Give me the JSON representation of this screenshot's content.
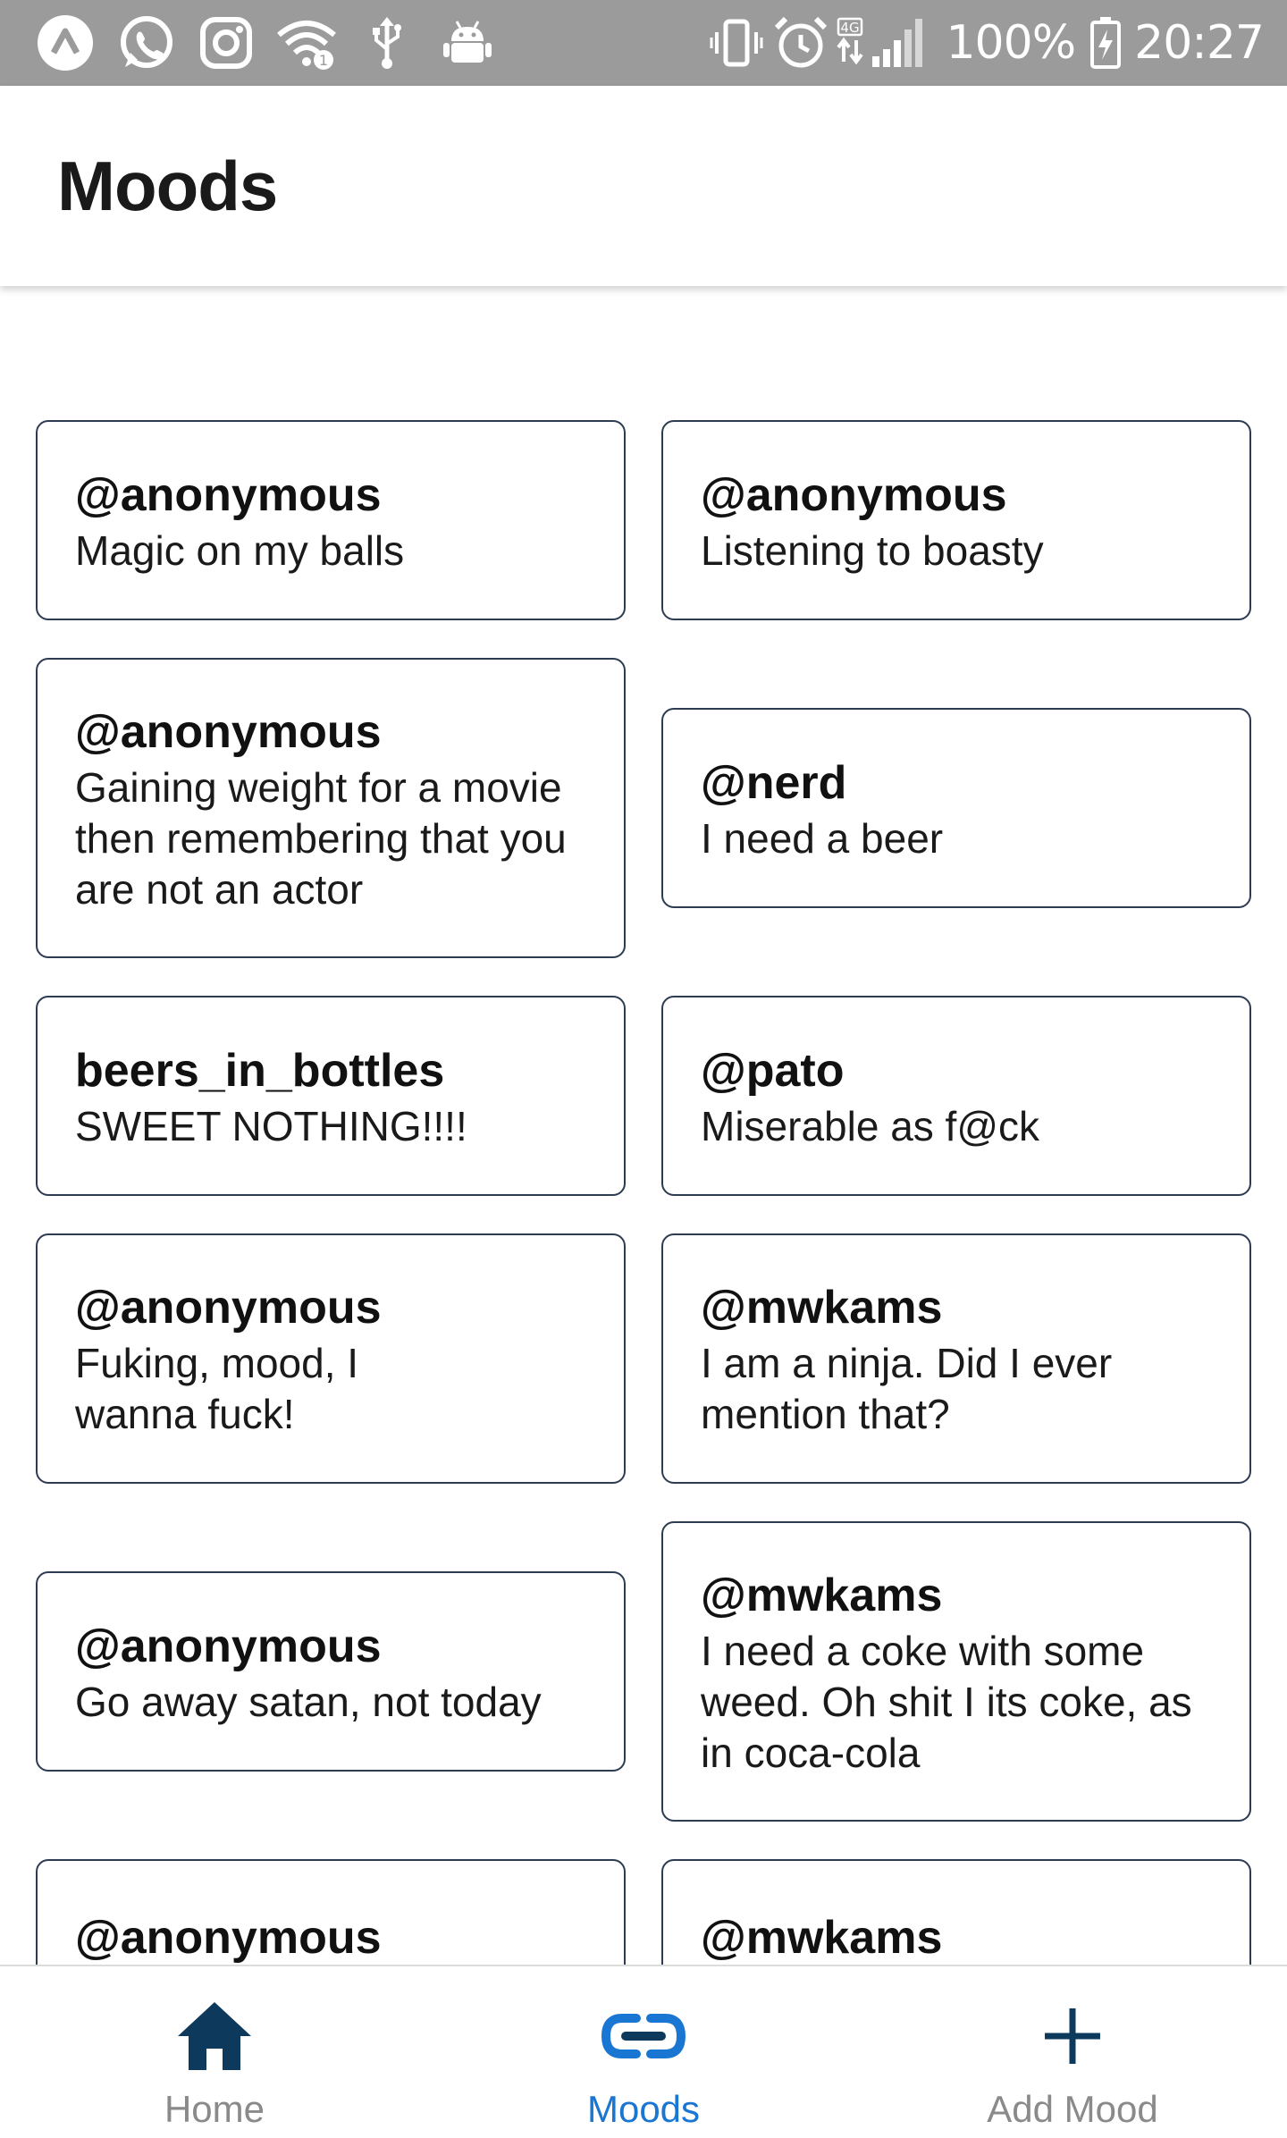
{
  "status_bar": {
    "battery": "100%",
    "time": "20:27",
    "network": "4G",
    "left_icons": [
      "app-a-icon",
      "whatsapp-icon",
      "instagram-icon",
      "wifi-icon",
      "usb-icon",
      "android-icon"
    ],
    "right_icons": [
      "vibrate-icon",
      "alarm-icon",
      "signal-icon",
      "battery-charging-icon"
    ]
  },
  "header": {
    "title": "Moods"
  },
  "moods": [
    {
      "user": "@anonymous",
      "text": "Magic on my balls"
    },
    {
      "user": "@anonymous",
      "text": "Listening to boasty"
    },
    {
      "user": "@anonymous",
      "text": "Gaining weight for a movie then remembering that you are not an actor"
    },
    {
      "user": "@nerd",
      "text": "I need a beer"
    },
    {
      "user": "beers_in_bottles",
      "text": "SWEET NOTHING!!!!"
    },
    {
      "user": "@pato",
      "text": "Miserable as f@ck"
    },
    {
      "user": "@anonymous",
      "text": "Fuking, mood, I wanna fuck!"
    },
    {
      "user": "@mwkams",
      "text": "I am a ninja. Did I ever mention that?"
    },
    {
      "user": "@anonymous",
      "text": "Go away satan, not today"
    },
    {
      "user": "@mwkams",
      "text": "I need a coke with some weed. Oh shit I its coke, as in coca-cola"
    },
    {
      "user": "@anonymous",
      "text": ""
    },
    {
      "user": "@mwkams",
      "text": ""
    }
  ],
  "bottom_nav": {
    "items": [
      {
        "label": "Home",
        "icon": "home-icon"
      },
      {
        "label": "Moods",
        "icon": "link-icon"
      },
      {
        "label": "Add Mood",
        "icon": "plus-icon"
      }
    ],
    "active": "Moods",
    "colors": {
      "active": "#1976d2",
      "icon": "#0d3a5c",
      "inactive_label": "#8a8a8a"
    }
  }
}
